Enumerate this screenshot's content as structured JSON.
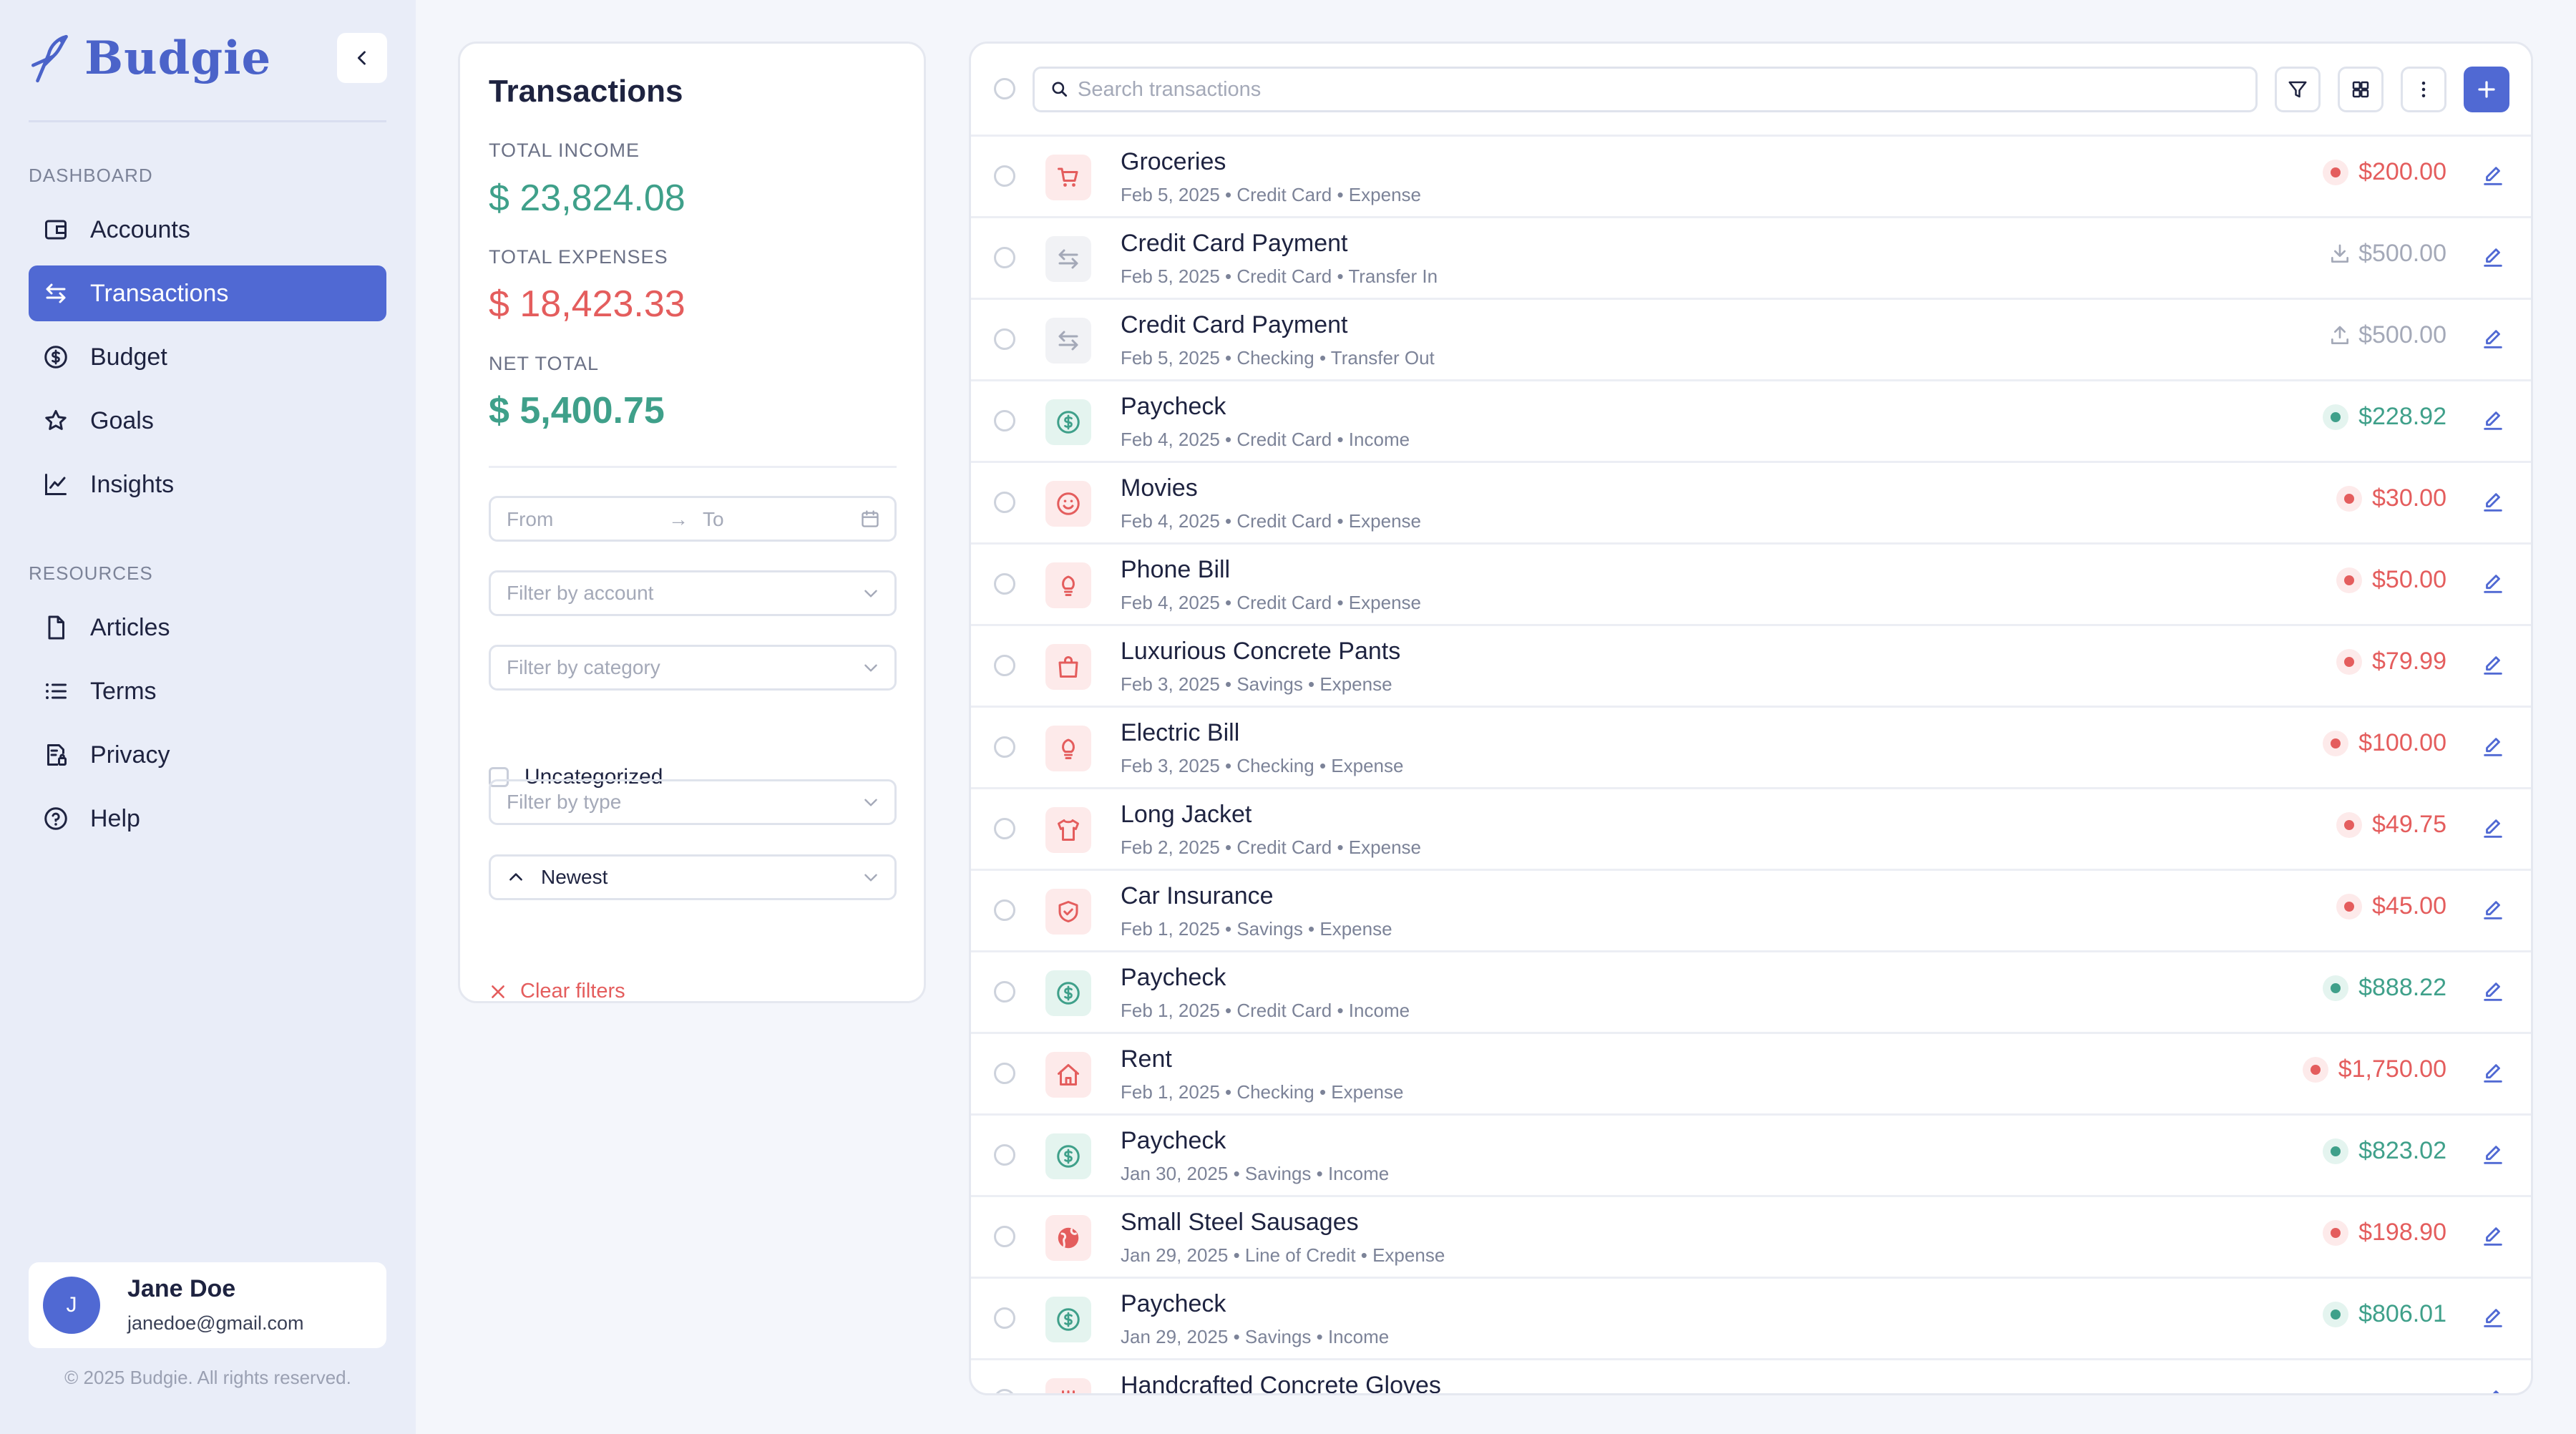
{
  "app": {
    "name": "Budgie",
    "accent": "#5069d3",
    "income_color": "#3fa08a",
    "expense_color": "#e45d5d"
  },
  "sidebar": {
    "dashboard_label": "DASHBOARD",
    "resources_label": "RESOURCES",
    "dashboard_items": [
      {
        "label": "Accounts",
        "icon": "wallet-icon"
      },
      {
        "label": "Transactions",
        "icon": "transfer-arrows-icon",
        "active": true
      },
      {
        "label": "Budget",
        "icon": "dollar-circle-icon"
      },
      {
        "label": "Goals",
        "icon": "star-icon"
      },
      {
        "label": "Insights",
        "icon": "line-chart-icon"
      }
    ],
    "resource_items": [
      {
        "label": "Articles",
        "icon": "file-icon"
      },
      {
        "label": "Terms",
        "icon": "list-icon"
      },
      {
        "label": "Privacy",
        "icon": "document-lock-icon"
      },
      {
        "label": "Help",
        "icon": "help-circle-icon"
      }
    ],
    "user": {
      "initial": "J",
      "name": "Jane Doe",
      "email": "janedoe@gmail.com"
    },
    "copyright": "© 2025 Budgie. All rights reserved."
  },
  "summary": {
    "title": "Transactions",
    "total_income_label": "TOTAL INCOME",
    "total_income": "$ 23,824.08",
    "total_expenses_label": "TOTAL EXPENSES",
    "total_expenses": "$ 18,423.33",
    "net_total_label": "NET TOTAL",
    "net_total": "$ 5,400.75"
  },
  "filters": {
    "date_from": "From",
    "date_arrow": "→",
    "date_to": "To",
    "account_placeholder": "Filter by account",
    "category_placeholder": "Filter by category",
    "uncategorized_label": "Uncategorized",
    "type_placeholder": "Filter by type",
    "sort_value": "Newest",
    "clear_label": "Clear filters"
  },
  "search": {
    "placeholder": "Search transactions"
  },
  "transactions": [
    {
      "name": "Groceries",
      "meta": "Feb 5, 2025 • Credit Card • Expense",
      "amount": "$200.00",
      "kind": "expense",
      "icon": "cart-icon"
    },
    {
      "name": "Credit Card Payment",
      "meta": "Feb 5, 2025 • Credit Card • Transfer In",
      "amount": "$500.00",
      "kind": "transfer-in",
      "icon": "transfer-icon"
    },
    {
      "name": "Credit Card Payment",
      "meta": "Feb 5, 2025 • Checking • Transfer Out",
      "amount": "$500.00",
      "kind": "transfer-out",
      "icon": "transfer-icon"
    },
    {
      "name": "Paycheck",
      "meta": "Feb 4, 2025 • Credit Card • Income",
      "amount": "$228.92",
      "kind": "income",
      "icon": "dollar-circle-icon"
    },
    {
      "name": "Movies",
      "meta": "Feb 4, 2025 • Credit Card • Expense",
      "amount": "$30.00",
      "kind": "expense",
      "icon": "smile-icon"
    },
    {
      "name": "Phone Bill",
      "meta": "Feb 4, 2025 • Credit Card • Expense",
      "amount": "$50.00",
      "kind": "expense",
      "icon": "lightbulb-icon"
    },
    {
      "name": "Luxurious Concrete Pants",
      "meta": "Feb 3, 2025 • Savings • Expense",
      "amount": "$79.99",
      "kind": "expense",
      "icon": "shopping-bag-icon"
    },
    {
      "name": "Electric Bill",
      "meta": "Feb 3, 2025 • Checking • Expense",
      "amount": "$100.00",
      "kind": "expense",
      "icon": "lightbulb-icon"
    },
    {
      "name": "Long Jacket",
      "meta": "Feb 2, 2025 • Credit Card • Expense",
      "amount": "$49.75",
      "kind": "expense",
      "icon": "shirt-icon"
    },
    {
      "name": "Car Insurance",
      "meta": "Feb 1, 2025 • Savings • Expense",
      "amount": "$45.00",
      "kind": "expense",
      "icon": "shield-check-icon"
    },
    {
      "name": "Paycheck",
      "meta": "Feb 1, 2025 • Credit Card • Income",
      "amount": "$888.22",
      "kind": "income",
      "icon": "dollar-circle-icon"
    },
    {
      "name": "Rent",
      "meta": "Feb 1, 2025 • Checking • Expense",
      "amount": "$1,750.00",
      "kind": "expense",
      "icon": "home-icon"
    },
    {
      "name": "Paycheck",
      "meta": "Jan 30, 2025 • Savings • Income",
      "amount": "$823.02",
      "kind": "income",
      "icon": "dollar-circle-icon"
    },
    {
      "name": "Small Steel Sausages",
      "meta": "Jan 29, 2025 • Line of Credit • Expense",
      "amount": "$198.90",
      "kind": "expense",
      "icon": "globe-icon"
    },
    {
      "name": "Paycheck",
      "meta": "Jan 29, 2025 • Savings • Income",
      "amount": "$806.01",
      "kind": "income",
      "icon": "dollar-circle-icon"
    },
    {
      "name": "Handcrafted Concrete Gloves",
      "meta": "",
      "amount": "",
      "kind": "expense",
      "icon": "utensils-icon"
    }
  ]
}
